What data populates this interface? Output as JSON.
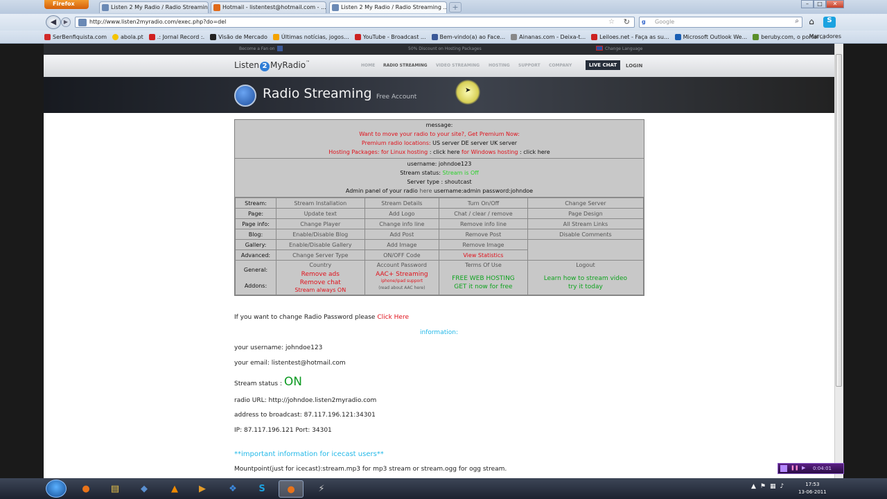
{
  "browser": {
    "menu_label": "Firefox",
    "tabs": [
      {
        "title": "Listen 2 My Radio / Radio Streaming ...",
        "active": false
      },
      {
        "title": "Hotmail - listentest@hotmail.com - ...",
        "active": false
      },
      {
        "title": "Listen 2 My Radio / Radio Streaming ...",
        "active": true
      }
    ],
    "new_tab": "+",
    "url": "http://www.listen2myradio.com/exec.php?do=del",
    "search_placeholder": "Google",
    "search_engine_letter": "g",
    "bookmarks": [
      {
        "label": "SerBenfiquista.com",
        "color": "#d12a2a"
      },
      {
        "label": "abola.pt",
        "color": "#f4c400"
      },
      {
        "label": ".: Jornal Record :.",
        "color": "#d02020"
      },
      {
        "label": "Visão de Mercado",
        "color": "#222222"
      },
      {
        "label": "Últimas notícias, jogos...",
        "color": "#f4a300"
      },
      {
        "label": "YouTube - Broadcast ...",
        "color": "#cc2222"
      },
      {
        "label": "Bem-vindo(a) ao Face...",
        "color": "#3b5998"
      },
      {
        "label": "Ainanas.com - Deixa-t...",
        "color": "#888888"
      },
      {
        "label": "Leiloes.net - Faça as su...",
        "color": "#cc2222"
      },
      {
        "label": "Microsoft Outlook We...",
        "color": "#1a5fb4"
      },
      {
        "label": "beruby.com, o portal ...",
        "color": "#5a8f2a"
      }
    ],
    "bookmarks_menu": "Marcadores"
  },
  "site": {
    "top_strip": {
      "fan": "Become a Fan on",
      "promo": "50% Discount on Hosting Packages",
      "language": "Change Language"
    },
    "logo": {
      "left": "Listen",
      "mid": "2",
      "right": "MyRadio",
      "tm": "™"
    },
    "nav": [
      "HOME",
      "RADIO STREAMING",
      "VIDEO STREAMING",
      "HOSTING",
      "SUPPORT",
      "COMPANY"
    ],
    "live_chat": "LIVE CHAT",
    "login": "LOGIN",
    "banner": {
      "title": "Radio Streaming",
      "subtitle": "Free Account"
    }
  },
  "panel": {
    "message_label": "message:",
    "promo1": "Want to move your radio to your site?, Get Premium Now:",
    "premium_prefix": "Premium radio locations:",
    "premium_servers": "US server DE server UK server",
    "hosting_linux": "Hosting Packages: for Linux hosting",
    "hosting_linux_link": ": click here",
    "hosting_windows": "for Windows hosting",
    "hosting_windows_link": ": click here",
    "username_line": "username: johndoe123",
    "stream_status_label": "Stream status:",
    "stream_status_value": "Stream is Off",
    "server_type": "Server type : shoutcast",
    "admin_prefix": "Admin panel of your radio",
    "admin_here": "here",
    "admin_creds": "username:admin password:johndoe",
    "rows": [
      {
        "label": "Stream:",
        "cells": [
          "Stream Installation",
          "Stream Details",
          "Turn On/Off",
          "Change Server"
        ]
      },
      {
        "label": "Page:",
        "cells": [
          "Update text",
          "Add Logo",
          "Chat / clear / remove",
          "Page Design"
        ]
      },
      {
        "label": "Page info:",
        "cells": [
          "Change Player",
          "Change info line",
          "Remove info line",
          "All Stream Links"
        ]
      },
      {
        "label": "Blog:",
        "cells": [
          "Enable/Disable Blog",
          "Add Post",
          "Remove Post",
          "Disable Comments"
        ]
      },
      {
        "label": "Gallery:",
        "cells": [
          "Enable/Disable Gallery",
          "Add Image",
          "Remove Image",
          ""
        ]
      },
      {
        "label": "Advanced:",
        "cells": [
          "Change Server Type",
          "ON/OFF Code",
          "View Statistics"
        ]
      },
      {
        "label": "General:",
        "cells": [
          "Country",
          "Account Password",
          "Terms Of Use",
          "Logout"
        ]
      }
    ],
    "addons": {
      "label": "Addons:",
      "col1": [
        "Remove ads",
        "Remove chat",
        "Stream always ON"
      ],
      "col2_title": "AAC+ Streaming",
      "col2_sub": "iphone/ipad support",
      "col2_note": "(read about AAC here)",
      "col3": [
        "FREE WEB HOSTING",
        "GET it now for free"
      ],
      "col4": [
        "Learn how to stream video",
        "try it today"
      ]
    }
  },
  "info": {
    "pw_prefix": "If you want to change Radio Password please",
    "pw_link": "Click Here",
    "heading": "information:",
    "username": "your username: johndoe123",
    "email": "your email: listentest@hotmail.com",
    "status_label": "Stream status :",
    "status_value": "ON",
    "radio_url": "radio URL: http://johndoe.listen2myradio.com",
    "broadcast": "address to broadcast: 87.117.196.121:34301",
    "ip": "IP: 87.117.196.121 Port: 34301",
    "icecast_heading": "**important information for icecast users**",
    "mountpoint": "Mountpoint(just for icecast):stream.mp3 for mp3 stream or stream.ogg for ogg stream."
  },
  "media_widget": {
    "time": "0:04:01"
  },
  "taskbar": {
    "apps": [
      {
        "name": "firefox",
        "glyph": "●",
        "color": "#e8731a"
      },
      {
        "name": "explorer",
        "glyph": "▤",
        "color": "#e8c24a"
      },
      {
        "name": "network",
        "glyph": "◆",
        "color": "#5a8fd0"
      },
      {
        "name": "vlc",
        "glyph": "▲",
        "color": "#f08a00"
      },
      {
        "name": "media-player",
        "glyph": "▶",
        "color": "#e39b2a"
      },
      {
        "name": "dropbox",
        "glyph": "❖",
        "color": "#3d8be0"
      },
      {
        "name": "skype",
        "glyph": "S",
        "color": "#1ba2e0"
      },
      {
        "name": "firefox-active",
        "glyph": "●",
        "color": "#e8731a"
      },
      {
        "name": "winamp",
        "glyph": "⚡",
        "color": "#c9c9c9"
      }
    ],
    "time": "17:53",
    "date": "13-06-2011"
  }
}
